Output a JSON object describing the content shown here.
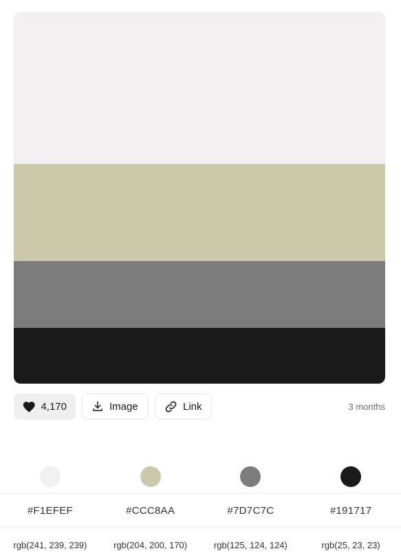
{
  "palette": {
    "colors": [
      {
        "hex": "#F1EFEF",
        "rgb": "rgb(241, 239, 239)",
        "fill": "#f1efef",
        "share": 0.41
      },
      {
        "hex": "#CCC8AA",
        "rgb": "rgb(204, 200, 170)",
        "fill": "#ccc8aa",
        "share": 0.26
      },
      {
        "hex": "#7D7C7C",
        "rgb": "rgb(125, 124, 124)",
        "fill": "#7d7c7c",
        "share": 0.18
      },
      {
        "hex": "#191717",
        "rgb": "rgb(25, 23, 23)",
        "fill": "#1b1a1a",
        "share": 0.15
      }
    ]
  },
  "actions": {
    "likes": "4,170",
    "like_icon": "heart-icon",
    "image_label": "Image",
    "image_icon": "download-icon",
    "link_label": "Link",
    "link_icon": "link-icon",
    "time_ago": "3 months"
  }
}
